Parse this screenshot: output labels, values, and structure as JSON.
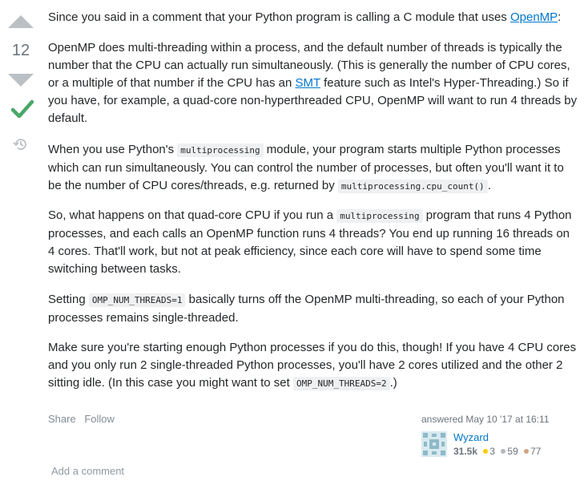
{
  "vote": {
    "count": "12"
  },
  "post": {
    "p1": {
      "text": "Since you said in a comment that your Python program is calling a C module that uses ",
      "link": "OpenMP",
      "tail": ":"
    },
    "p2": {
      "a": "OpenMP does multi-threading within a process, and the default number of threads is typically the number that the CPU can actually run simultaneously. (This is generally the number of CPU cores, or a multiple of that number if the CPU has an ",
      "link": "SMT",
      "b": " feature such as Intel's Hyper-Threading.) So if you have, for example, a quad-core non-hyperthreaded CPU, OpenMP will want to run 4 threads by default."
    },
    "p3": {
      "a": "When you use Python's ",
      "code1": "multiprocessing",
      "b": " module, your program starts multiple Python processes which can run simultaneously. You can control the number of processes, but often you'll want it to be the number of CPU cores/threads, e.g. returned by ",
      "code2": "multiprocessing.cpu_count()",
      "c": "."
    },
    "p4": {
      "a": "So, what happens on that quad-core CPU if you run a ",
      "code1": "multiprocessing",
      "b": " program that runs 4 Python processes, and each calls an OpenMP function runs 4 threads? You end up running 16 threads on 4 cores. That'll work, but not at peak efficiency, since each core will have to spend some time switching between tasks."
    },
    "p5": {
      "a": "Setting ",
      "code1": "OMP_NUM_THREADS=1",
      "b": " basically turns off the OpenMP multi-threading, so each of your Python processes remains single-threaded."
    },
    "p6": {
      "a": "Make sure you're starting enough Python processes if you do this, though! If you have 4 CPU cores and you only run 2 single-threaded Python processes, you'll have 2 cores utilized and the other 2 sitting idle. (In this case you might want to set ",
      "code1": "OMP_NUM_THREADS=2",
      "b": ".)"
    }
  },
  "menu": {
    "share": "Share",
    "follow": "Follow"
  },
  "signature": {
    "action": "answered",
    "time": "May 10 '17 at 16:11",
    "user": "Wyzard",
    "reputation": "31.5k",
    "gold": "3",
    "silver": "59",
    "bronze": "77"
  },
  "comments": {
    "add": "Add a comment"
  },
  "colors": {
    "accepted": "#48a868",
    "vote_arrow": "#bbc0c4",
    "link": "#0077cc",
    "gold": "#ffcc01",
    "silver": "#b4b8bc",
    "bronze": "#d1a684"
  }
}
